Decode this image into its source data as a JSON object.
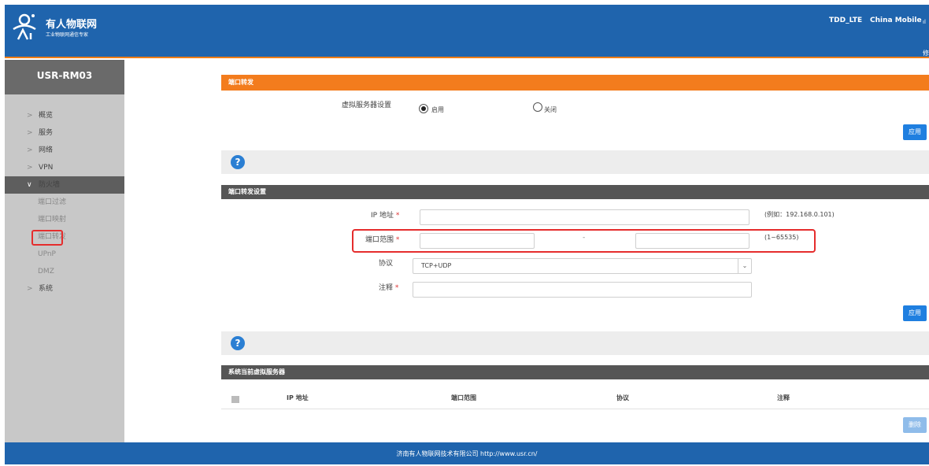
{
  "header": {
    "brand_title": "有人物联网",
    "brand_subtitle": "工业物联网通信专家",
    "network_type": "TDD_LTE",
    "carrier": "China Mobile",
    "signal_glyph": "ıl",
    "header_link": "修"
  },
  "sidebar": {
    "device_name": "USR-RM03",
    "items": [
      {
        "chev": ">",
        "label": "概览"
      },
      {
        "chev": ">",
        "label": "服务"
      },
      {
        "chev": ">",
        "label": "网络"
      },
      {
        "chev": ">",
        "label": "VPN"
      },
      {
        "chev": "∨",
        "label": "防火墙"
      }
    ],
    "sub_items": [
      "端口过滤",
      "端口映射",
      "端口转发",
      "UPnP",
      "DMZ"
    ],
    "last_item": {
      "chev": ">",
      "label": "系统"
    }
  },
  "section1": {
    "title": "端口转发",
    "vserver_label": "虚拟服务器设置",
    "enable_label": "启用",
    "disable_label": "关闭",
    "apply_label": "应用"
  },
  "section2": {
    "title": "端口转发设置",
    "ip_label": "IP 地址",
    "ip_hint": "(例如：192.168.0.101)",
    "port_label": "端口范围",
    "port_separator": "-",
    "port_hint": "(1~65535)",
    "protocol_label": "协议",
    "protocol_value": "TCP+UDP",
    "comment_label": "注释",
    "required_mark": "*",
    "apply_label": "应用"
  },
  "section3": {
    "title": "系统当前虚拟服务器",
    "columns": [
      "IP 地址",
      "端口范围",
      "协议",
      "注释"
    ],
    "delete_label": "删除"
  },
  "help_glyph": "?",
  "footer": {
    "text": "济南有人物联网技术有限公司  http://www.usr.cn/"
  }
}
